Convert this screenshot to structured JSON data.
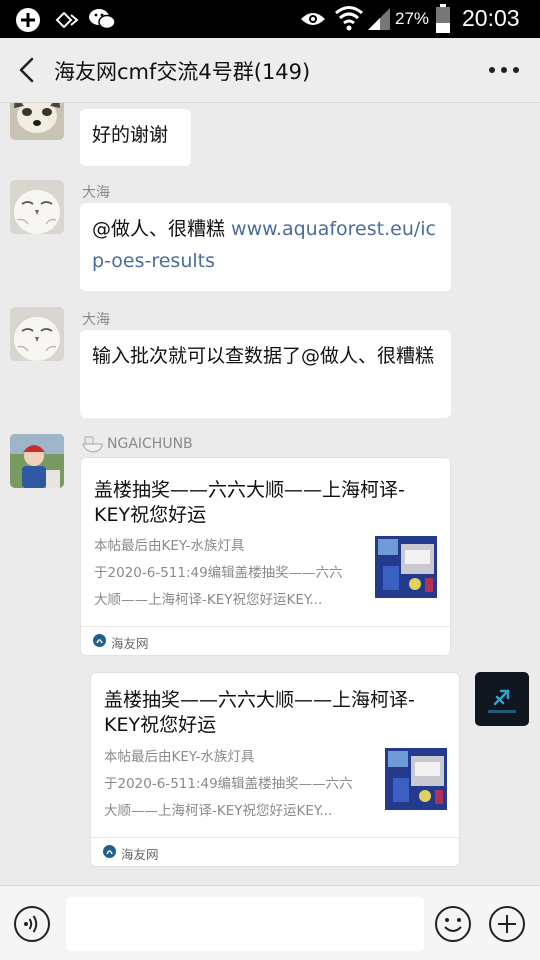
{
  "status_bar": {
    "battery": "27%",
    "time": "20:03"
  },
  "header": {
    "title": "海友网cmf交流4号群(149)"
  },
  "messages": [
    {
      "text": "好的谢谢"
    },
    {
      "sender": "大海",
      "text_prefix": "@做人、很糟糕 ",
      "link": "www.aquaforest.eu/icp-oes-results"
    },
    {
      "sender": "大海",
      "text": "输入批次就可以查数据了@做人、很糟糕"
    },
    {
      "sender": "NGAICHUNB",
      "card": {
        "title": "盖楼抽奖——六六大顺——上海柯译-KEY祝您好运",
        "desc_line1": "本帖最后由KEY-水族灯具",
        "desc_line2": "于2020-6-511:49编辑盖楼抽奖——六六",
        "desc_line3": "大顺——上海柯译-KEY祝您好运KEY...",
        "source": "海友网"
      }
    },
    {
      "card": {
        "title": "盖楼抽奖——六六大顺——上海柯译-KEY祝您好运",
        "desc_line1": "本帖最后由KEY-水族灯具",
        "desc_line2": "于2020-6-511:49编辑盖楼抽奖——六六",
        "desc_line3": "大顺——上海柯译-KEY祝您好运KEY...",
        "source": "海友网"
      }
    }
  ],
  "input": {
    "placeholder": ""
  }
}
